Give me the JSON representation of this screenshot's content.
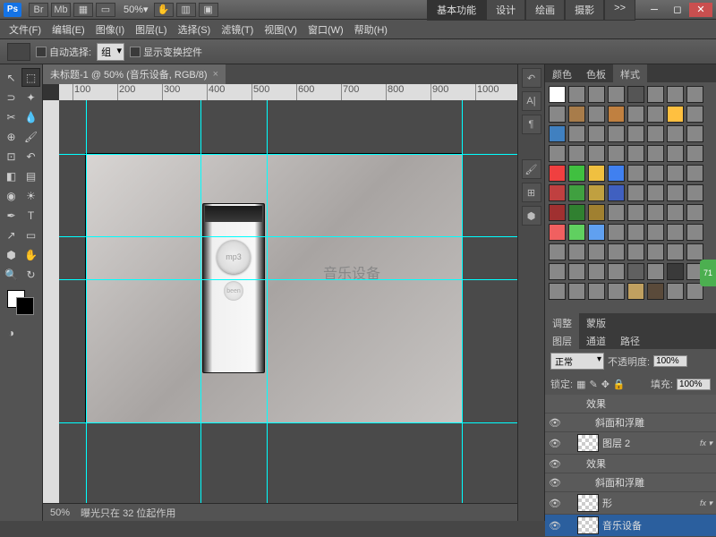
{
  "titlebar": {
    "logo": "Ps",
    "zoom": "50%",
    "workspace_tabs": [
      "基本功能",
      "设计",
      "绘画",
      "摄影"
    ],
    "active_ws": 0,
    "expand": ">>"
  },
  "menubar": [
    "文件(F)",
    "编辑(E)",
    "图像(I)",
    "图层(L)",
    "选择(S)",
    "滤镜(T)",
    "视图(V)",
    "窗口(W)",
    "帮助(H)"
  ],
  "optbar": {
    "auto_select": "自动选择:",
    "group": "组",
    "show_transform": "显示变换控件"
  },
  "document": {
    "tab_title": "未标题-1 @ 50% (音乐设备, RGB/8)",
    "canvas_text": "音乐设备",
    "mp3_label": "mp3",
    "btn2_label": "been"
  },
  "ruler_ticks": [
    "100",
    "200",
    "300",
    "400",
    "500",
    "600",
    "700",
    "800",
    "900",
    "1000"
  ],
  "statusbar": {
    "zoom": "50%",
    "info": "曝光只在 32 位起作用"
  },
  "panels": {
    "swatch_tabs": [
      "颜色",
      "色板",
      "样式"
    ],
    "swatch_active": 2,
    "adjust_tabs": [
      "调整",
      "蒙版"
    ],
    "layer_tabs": [
      "图层",
      "通道",
      "路径"
    ],
    "layer_active": 0,
    "blend_mode": "正常",
    "opacity_label": "不透明度:",
    "opacity": "100%",
    "lock_label": "锁定:",
    "fill_label": "填充:",
    "fill": "100%",
    "layers": [
      {
        "name": "效果",
        "indent": 2,
        "eye": false,
        "fx": false,
        "thumb": false
      },
      {
        "name": "斜面和浮雕",
        "indent": 3,
        "eye": true,
        "fx": false,
        "thumb": false
      },
      {
        "name": "图层 2",
        "indent": 1,
        "eye": true,
        "fx": true,
        "thumb": true
      },
      {
        "name": "效果",
        "indent": 2,
        "eye": true,
        "fx": false,
        "thumb": false
      },
      {
        "name": "斜面和浮雕",
        "indent": 3,
        "eye": true,
        "fx": false,
        "thumb": false
      },
      {
        "name": "形",
        "indent": 1,
        "eye": true,
        "fx": true,
        "thumb": true
      },
      {
        "name": "音乐设备",
        "indent": 1,
        "eye": true,
        "fx": false,
        "thumb": true,
        "sel": true
      }
    ]
  },
  "style_colors": [
    "#fff",
    "#888",
    "#888",
    "#888",
    "#555",
    "#888",
    "#888",
    "#888",
    "#888",
    "#a87c4a",
    "#888",
    "#c08040",
    "#888",
    "#888",
    "#ffc040",
    "#888",
    "#4080c0",
    "#888",
    "#888",
    "#888",
    "#888",
    "#888",
    "#888",
    "#888",
    "#888",
    "#888",
    "#888",
    "#888",
    "#888",
    "#888",
    "#888",
    "#888",
    "#f04040",
    "#40c040",
    "#f0c040",
    "#4080f0",
    "#888",
    "#888",
    "#888",
    "#888",
    "#c04040",
    "#40a040",
    "#c0a040",
    "#4060c0",
    "#888",
    "#888",
    "#888",
    "#888",
    "#a03030",
    "#308030",
    "#a08030",
    "#888",
    "#888",
    "#888",
    "#888",
    "#888",
    "#f06060",
    "#60d060",
    "#60a0f0",
    "#888",
    "#888",
    "#888",
    "#888",
    "#888",
    "#888",
    "#888",
    "#888",
    "#888",
    "#888",
    "#888",
    "#888",
    "#888",
    "#888",
    "#888",
    "#888",
    "#888",
    "#606060",
    "#888",
    "#3a3a3a",
    "#888",
    "#888",
    "#888",
    "#888",
    "#888",
    "#c0a060",
    "#5a4a3a",
    "#888",
    "#888"
  ],
  "green_tab": "71"
}
